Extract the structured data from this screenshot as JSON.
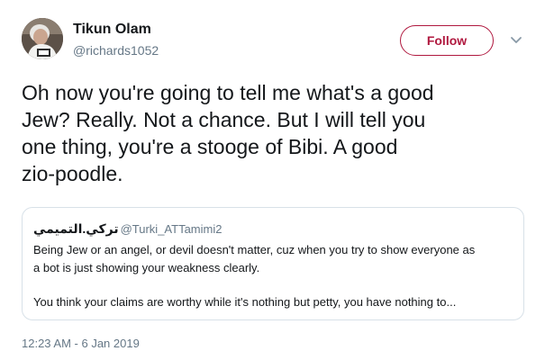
{
  "author": {
    "name": "Tikun Olam",
    "handle": "@richards1052",
    "avatar": "avatar"
  },
  "follow": {
    "label": "Follow",
    "color": "#b0193f"
  },
  "menu": {
    "icon": "chevron-down-icon"
  },
  "tweet": {
    "text": "Oh now you're going to tell me what's a good\nJew?  Really. Not a chance. But I will tell you\none thing,  you're a stooge of Bibi. A good\nzio-poodle."
  },
  "quote": {
    "name": "تركي.التميمي",
    "handle": "@Turki_ATTamimi2",
    "lines": [
      "Being Jew or an angel, or devil doesn't matter, cuz when you try to show everyone as",
      "a bot is just showing your weakness clearly.",
      "You think your claims are worthy while it's nothing but petty, you have nothing to..."
    ]
  },
  "timestamp": "12:23 AM - 6 Jan 2019",
  "colors": {
    "text": "#14171a",
    "secondary": "#657786",
    "border": "#d8e1e8"
  }
}
